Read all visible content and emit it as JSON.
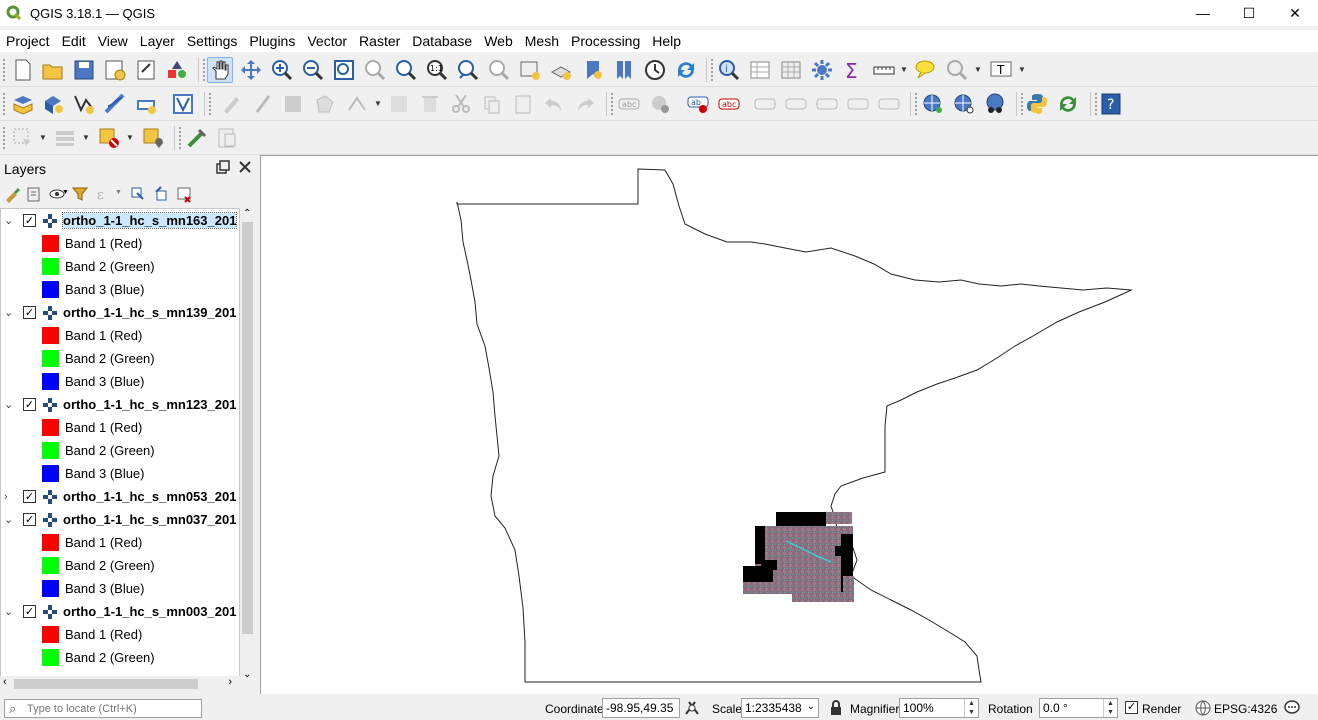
{
  "window": {
    "title": "QGIS 3.18.1 — QGIS",
    "minimize": "—",
    "maximize": "☐",
    "close": "✕"
  },
  "menu": [
    "Project",
    "Edit",
    "View",
    "Layer",
    "Settings",
    "Plugins",
    "Vector",
    "Raster",
    "Database",
    "Web",
    "Mesh",
    "Processing",
    "Help"
  ],
  "layers_panel": {
    "title": "Layers",
    "rows": [
      {
        "type": "layer",
        "name": "ortho_1-1_hc_s_mn163_201",
        "expanded": true,
        "checked": true,
        "selected": true
      },
      {
        "type": "band",
        "label": "Band 1 (Red)",
        "color": "#ff0000"
      },
      {
        "type": "band",
        "label": "Band 2 (Green)",
        "color": "#00ff00"
      },
      {
        "type": "band",
        "label": "Band 3 (Blue)",
        "color": "#0000ff"
      },
      {
        "type": "layer",
        "name": "ortho_1-1_hc_s_mn139_201",
        "expanded": true,
        "checked": true,
        "selected": false
      },
      {
        "type": "band",
        "label": "Band 1 (Red)",
        "color": "#ff0000"
      },
      {
        "type": "band",
        "label": "Band 2 (Green)",
        "color": "#00ff00"
      },
      {
        "type": "band",
        "label": "Band 3 (Blue)",
        "color": "#0000ff"
      },
      {
        "type": "layer",
        "name": "ortho_1-1_hc_s_mn123_201",
        "expanded": true,
        "checked": true,
        "selected": false
      },
      {
        "type": "band",
        "label": "Band 1 (Red)",
        "color": "#ff0000"
      },
      {
        "type": "band",
        "label": "Band 2 (Green)",
        "color": "#00ff00"
      },
      {
        "type": "band",
        "label": "Band 3 (Blue)",
        "color": "#0000ff"
      },
      {
        "type": "layer",
        "name": "ortho_1-1_hc_s_mn053_201",
        "expanded": false,
        "checked": true,
        "selected": false
      },
      {
        "type": "layer",
        "name": "ortho_1-1_hc_s_mn037_201",
        "expanded": true,
        "checked": true,
        "selected": false
      },
      {
        "type": "band",
        "label": "Band 1 (Red)",
        "color": "#ff0000"
      },
      {
        "type": "band",
        "label": "Band 2 (Green)",
        "color": "#00ff00"
      },
      {
        "type": "band",
        "label": "Band 3 (Blue)",
        "color": "#0000ff"
      },
      {
        "type": "layer",
        "name": "ortho_1-1_hc_s_mn003_201",
        "expanded": true,
        "checked": true,
        "selected": false
      },
      {
        "type": "band",
        "label": "Band 1 (Red)",
        "color": "#ff0000"
      },
      {
        "type": "band",
        "label": "Band 2 (Green)",
        "color": "#00ff00"
      }
    ]
  },
  "statusbar": {
    "locator_placeholder": "Type to locate (Ctrl+K)",
    "coordinate_label": "Coordinate",
    "coordinate_value": "-98.95,49.35",
    "scale_label": "Scale",
    "scale_value": "1:2335438",
    "magnifier_label": "Magnifier",
    "magnifier_value": "100%",
    "rotation_label": "Rotation",
    "rotation_value": "0.0 °",
    "render_label": "Render",
    "render_checked": true,
    "crs_label": "EPSG:4326"
  }
}
